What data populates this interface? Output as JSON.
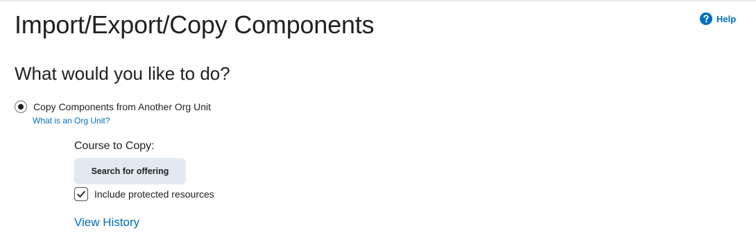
{
  "page": {
    "title": "Import/Export/Copy Components"
  },
  "help": {
    "label": "Help",
    "icon": "question-circle-icon",
    "color": "#006fbf"
  },
  "section": {
    "heading": "What would you like to do?"
  },
  "options": [
    {
      "label": "Copy Components from Another Org Unit",
      "selected": true,
      "help_link": "What is an Org Unit?"
    }
  ],
  "copy_form": {
    "course_label": "Course to Copy:",
    "search_button_label": "Search for offering",
    "include_protected": {
      "label": "Include protected resources",
      "checked": true
    },
    "view_history_label": "View History"
  },
  "colors": {
    "link": "#006fbf",
    "button_bg": "#e3e9f1",
    "text": "#202122"
  }
}
